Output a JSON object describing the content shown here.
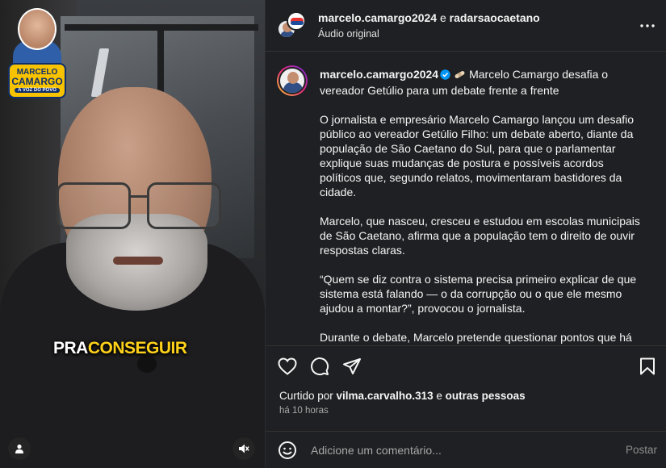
{
  "video": {
    "badge": {
      "line1": "MARCELO",
      "line2": "CAMARGO",
      "line3": "A VOZ DO POVO"
    },
    "subtitle": {
      "word1": "PRA",
      "word2": "CONSEGUIR"
    },
    "icons": {
      "user": "user-icon",
      "mute": "muted-speaker-icon"
    }
  },
  "header": {
    "user1": "marcelo.camargo2024",
    "connector": " e ",
    "user2": "radarsaocaetano",
    "audio": "Áudio original",
    "more_icon": "more-horizontal-icon"
  },
  "caption": {
    "username": "marcelo.camargo2024",
    "title": "Marcelo Camargo desafia o vereador Getúlio para um debate frente a frente",
    "paragraphs": [
      "O jornalista e empresário Marcelo Camargo lançou um desafio público ao vereador Getúlio Filho: um debate aberto, diante da população de São Caetano do Sul, para que o parlamentar explique suas mudanças de postura e possíveis acordos políticos que, segundo relatos, movimentaram bastidores da cidade.",
      "Marcelo, que nasceu, cresceu e estudou em escolas municipais de São Caetano, afirma que a população tem o direito de ouvir respostas claras.",
      "“Quem se diz contra o sistema precisa primeiro explicar de que sistema está falando — o da corrupção ou o que ele mesmo ajudou a montar?”, provocou o jornalista.",
      "Durante o debate, Marcelo pretende questionar pontos que há muito tempo estão sem resposta:"
    ]
  },
  "actions": {
    "like": "heart-icon",
    "comment": "comment-icon",
    "share": "send-icon",
    "save": "bookmark-icon"
  },
  "likes": {
    "prefix": "Curtido por ",
    "user": "vilma.carvalho.313",
    "middle": " e ",
    "others": "outras pessoas"
  },
  "time": "há 10 horas",
  "comment": {
    "placeholder": "Adicione um comentário...",
    "post": "Postar"
  },
  "colors": {
    "background": "#1f2023",
    "verified": "#0095f6",
    "caption_yellow": "#ffd21a",
    "badge_yellow": "#f7c200"
  }
}
